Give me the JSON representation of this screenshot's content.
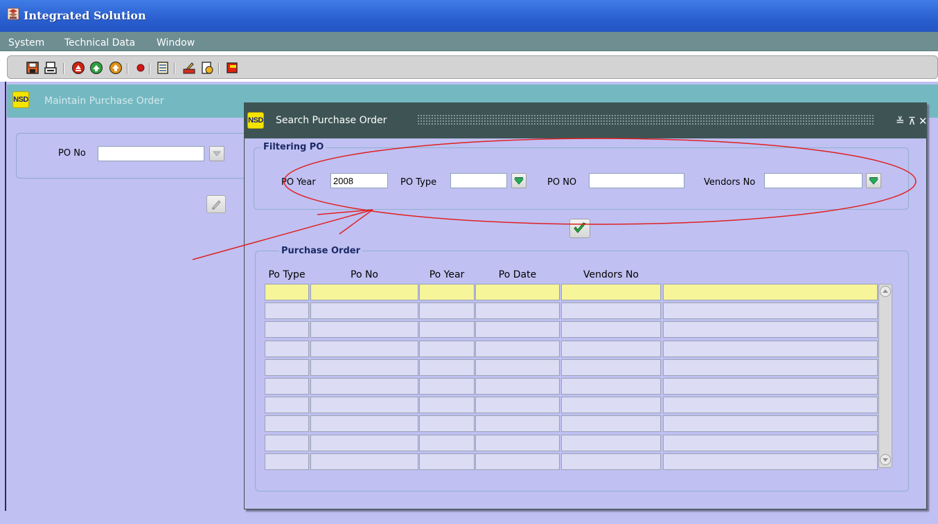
{
  "window": {
    "title": "Integrated Solution"
  },
  "menu": {
    "items": [
      "System",
      "Technical Data",
      "Window"
    ]
  },
  "toolbar": {
    "buttons": [
      "save-icon",
      "print-icon",
      "first-icon",
      "previous-icon",
      "next-icon",
      "stop-icon",
      "list-icon",
      "edit-icon",
      "document-icon",
      "exit-icon"
    ]
  },
  "main_form": {
    "badge": "NSD",
    "title": "Maintain Purchase Order",
    "po_no_label": "PO No",
    "po_no_value": ""
  },
  "dialog": {
    "badge": "NSD",
    "title": "Search Purchase Order",
    "controls": [
      "≚",
      "⊼",
      "✕"
    ],
    "filtering": {
      "group_title": "Filtering PO",
      "po_year_label": "PO Year",
      "po_year_value": "2008",
      "po_type_label": "PO Type",
      "po_type_value": "",
      "po_no_label": "PO NO",
      "po_no_value": "",
      "vendors_no_label": "Vendors No",
      "vendors_no_value": ""
    },
    "results": {
      "group_title": "Purchase Order",
      "columns": [
        "Po Type",
        "Po No",
        "Po Year",
        "Po Date",
        "Vendors No"
      ],
      "row_count": 10
    }
  },
  "colors": {
    "accent": "#2a5fd0",
    "annotation": "#e02020",
    "selected_row": "#f6f59a"
  }
}
